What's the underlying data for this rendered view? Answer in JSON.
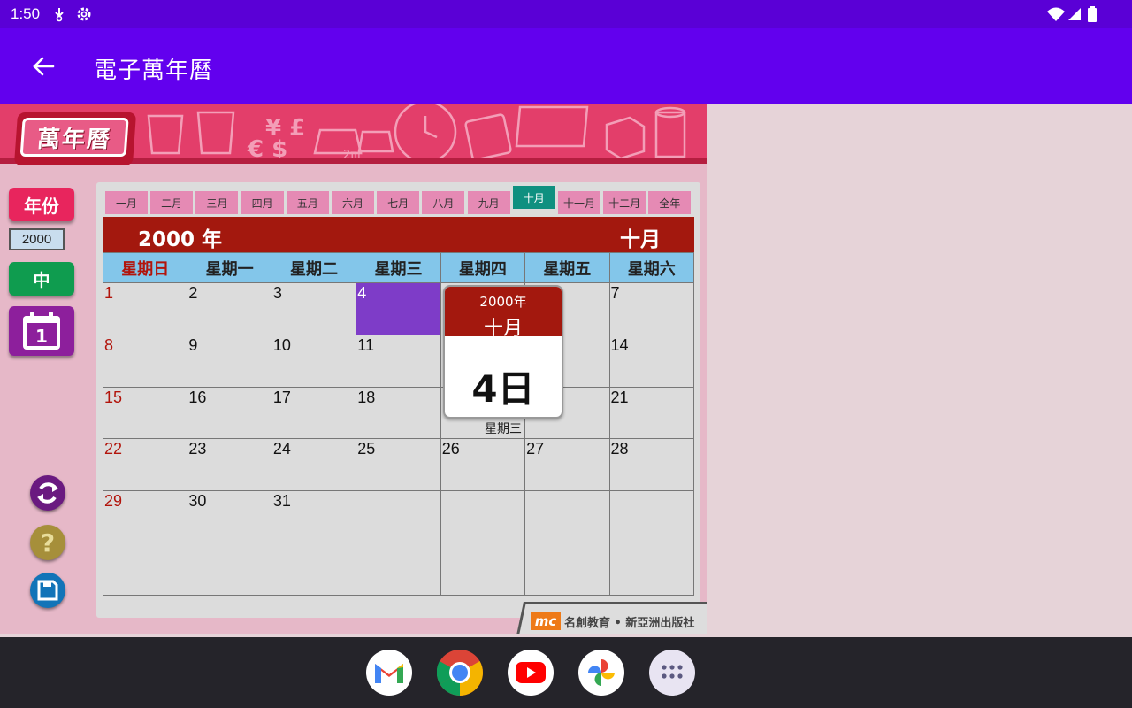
{
  "status_bar": {
    "time": "1:50"
  },
  "app_bar": {
    "title": "電子萬年曆"
  },
  "banner": {
    "logo_text": "萬年曆"
  },
  "controls": {
    "year_button": "年份",
    "year_value": "2000",
    "language_button": "中",
    "today_icon_number": "1"
  },
  "month_tabs": [
    "一月",
    "二月",
    "三月",
    "四月",
    "五月",
    "六月",
    "七月",
    "八月",
    "九月",
    "十月",
    "十一月",
    "十二月",
    "全年"
  ],
  "active_month_tab": "十月",
  "calendar": {
    "year_label": "2000 年",
    "month_label": "十月",
    "weekdays": [
      "星期日",
      "星期一",
      "星期二",
      "星期三",
      "星期四",
      "星期五",
      "星期六"
    ],
    "weeks": [
      [
        "1",
        "2",
        "3",
        "4",
        "",
        "",
        "7"
      ],
      [
        "8",
        "9",
        "10",
        "11",
        "",
        "",
        "14"
      ],
      [
        "15",
        "16",
        "17",
        "18",
        "",
        "",
        "21"
      ],
      [
        "22",
        "23",
        "24",
        "25",
        "26",
        "27",
        "28"
      ],
      [
        "29",
        "30",
        "31",
        "",
        "",
        "",
        ""
      ],
      [
        "",
        "",
        "",
        "",
        "",
        "",
        ""
      ]
    ],
    "selected_day": "4"
  },
  "popup": {
    "year": "2000年",
    "month": "十月",
    "day": "4日",
    "weekday": "星期三"
  },
  "footer": {
    "brand_logo": "mc",
    "brand_text": "名創教育 • 新亞洲出版社"
  },
  "dock": [
    "gmail-icon",
    "chrome-icon",
    "youtube-icon",
    "photos-icon",
    "app-drawer-icon"
  ]
}
